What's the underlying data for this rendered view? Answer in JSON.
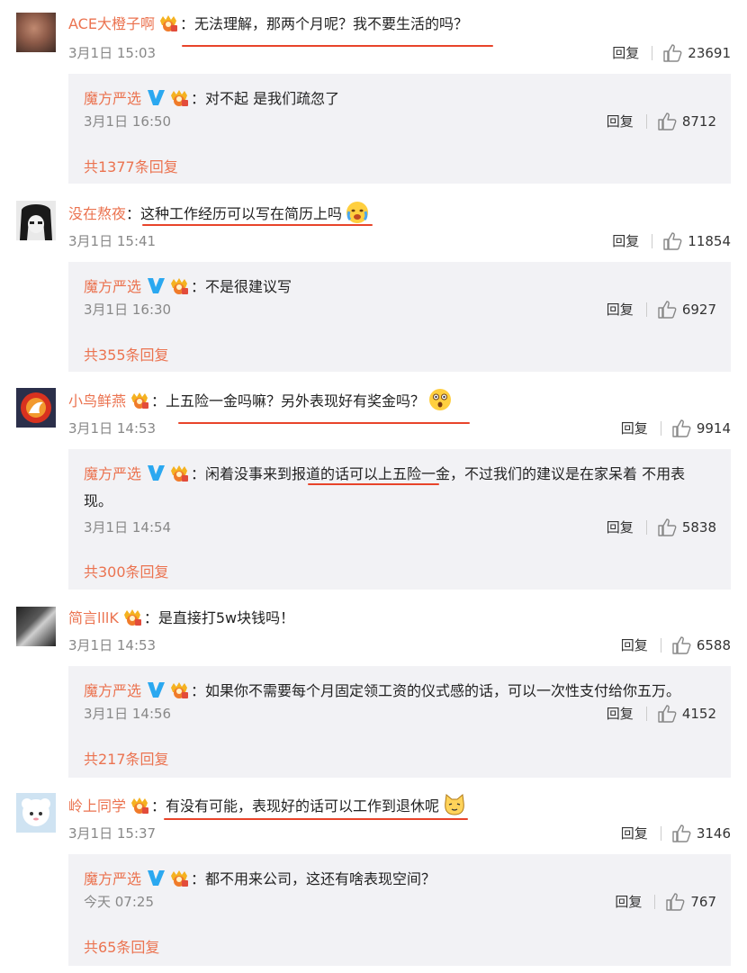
{
  "comments": [
    {
      "user": "ACE大橙子啊",
      "text": "：无法理解，那两个月呢？我不要生活的吗？",
      "time": "3月1日 15:03",
      "reply_label": "回复",
      "likes": "23691",
      "reply": {
        "user": "魔方严选",
        "text": "：对不起 是我们疏忽了",
        "time": "3月1日 16:50",
        "reply_label": "回复",
        "likes": "8712"
      },
      "more": "共1377条回复"
    },
    {
      "user": "没在熬夜",
      "text": "：这种工作经历可以写在简历上吗",
      "time": "3月1日 15:41",
      "reply_label": "回复",
      "likes": "11854",
      "reply": {
        "user": "魔方严选",
        "text": "：不是很建议写",
        "time": "3月1日 16:30",
        "reply_label": "回复",
        "likes": "6927"
      },
      "more": "共355条回复"
    },
    {
      "user": "小鸟鲜燕",
      "text": "：上五险一金吗嘛？另外表现好有奖金吗？",
      "time": "3月1日 14:53",
      "reply_label": "回复",
      "likes": "9914",
      "reply": {
        "user": "魔方严选",
        "text": "：闲着没事来到报道的话可以上五险一金，不过我们的建议是在家呆着 不用表现。",
        "time": "3月1日 14:54",
        "reply_label": "回复",
        "likes": "5838"
      },
      "more": "共300条回复"
    },
    {
      "user": "简言lllK",
      "text": "：是直接打5w块钱吗！",
      "time": "3月1日 14:53",
      "reply_label": "回复",
      "likes": "6588",
      "reply": {
        "user": "魔方严选",
        "text": "：如果你不需要每个月固定领工资的仪式感的话，可以一次性支付给你五万。",
        "time": "3月1日 14:56",
        "reply_label": "回复",
        "likes": "4152"
      },
      "more": "共217条回复"
    },
    {
      "user": "岭上同学",
      "text": "：有没有可能，表现好的话可以工作到退休呢",
      "time": "3月1日 15:37",
      "reply_label": "回复",
      "likes": "3146",
      "reply": {
        "user": "魔方严选",
        "text": "：都不用来公司，这还有啥表现空间？",
        "time": "今天 07:25",
        "reply_label": "回复",
        "likes": "767"
      },
      "more": "共65条回复"
    }
  ],
  "colors": {
    "username": "#eb7350",
    "underline": "#e8442a",
    "reply_bg": "#f2f2f5",
    "verified": "#2ba8f0"
  },
  "icons": [
    "crown-badge-icon",
    "verified-v-icon",
    "thumb-up-icon",
    "crying-emoji-icon",
    "surprised-emoji-icon",
    "cat-emoji-icon"
  ]
}
